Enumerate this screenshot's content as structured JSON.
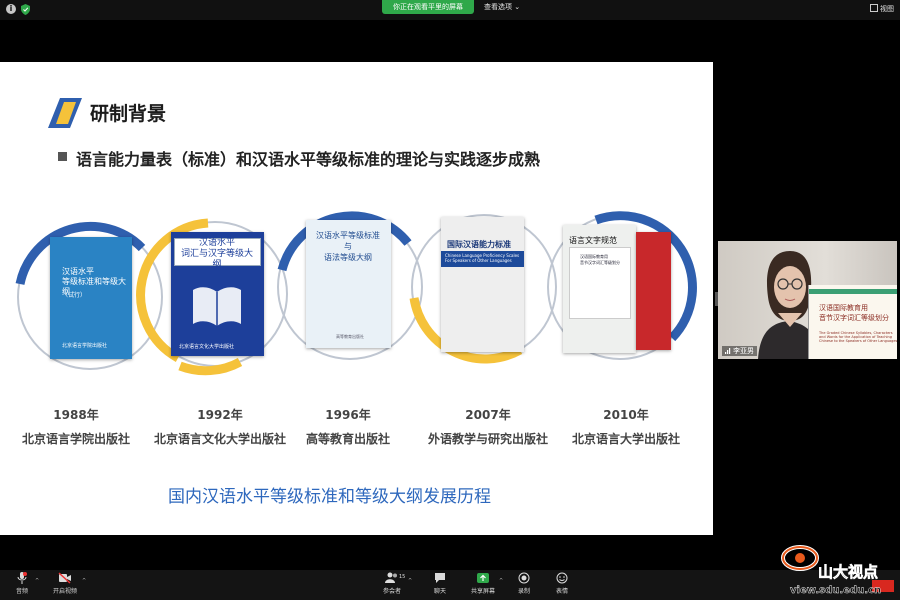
{
  "topbar": {
    "sharing_banner": "你正在观看平里的屏幕",
    "view_options": "查看选项",
    "view_button": "视图"
  },
  "slide": {
    "title": "研制背景",
    "subtitle": "语言能力量表（标准）和汉语水平等级标准的理论与实践逐步成熟",
    "caption": "国内汉语水平等级标准和等级大纲发展历程",
    "timeline": [
      {
        "year": "1988年",
        "publisher": "北京语言学院出版社",
        "arc_color": "#2f5fae"
      },
      {
        "year": "1992年",
        "publisher": "北京语言文化大学出版社",
        "arc_color": "#f5c23a"
      },
      {
        "year": "1996年",
        "publisher": "高等教育出版社",
        "arc_color": "#2f5fae"
      },
      {
        "year": "2007年",
        "publisher": "外语教学与研究出版社",
        "arc_color": "#f5c23a"
      },
      {
        "year": "2010年",
        "publisher": "北京语言大学出版社",
        "arc_color": "#2f5fae"
      }
    ],
    "books": {
      "b1": {
        "title": "汉语水平\n等级标准和等级大纲",
        "sub": "（试行）",
        "pub": "北京语言学院出版社"
      },
      "b2": {
        "title": "汉语水平\n词汇与汉字等级大纲",
        "pub": "北京语言文化大学出版社"
      },
      "b3": {
        "title": "汉语水平等级标准\n与\n语法等级大纲",
        "pub": "高等教育出版社"
      },
      "b4": {
        "title": "国际汉语能力标准",
        "en": "Chinese Language Proficiency Scales\nFor Speakers of Other Languages"
      },
      "b5": {
        "title": "语言文字规范",
        "inner": "汉语国际教育用\n音节汉字词汇等级划分"
      }
    }
  },
  "video": {
    "participant_name": "李亚男",
    "book_title": "汉语国际教育用\n音节汉字词汇等级划分",
    "book_en": "The Graded Chinese Syllables, Characters and Words for the Application of Teaching Chinese to the Speakers of Other Languages"
  },
  "toolbar": {
    "audio": "音频",
    "video": "开启视频",
    "participants": "参会者",
    "participants_count": "15",
    "chat": "聊天",
    "share": "共享屏幕",
    "record": "录制",
    "reactions": "表情"
  },
  "watermark": {
    "brand": "山大视点",
    "url": "view.sdu.edu.cn"
  },
  "colors": {
    "accent_blue": "#2f5fae",
    "accent_yellow": "#f5c23a",
    "caption_blue": "#2e68bd",
    "share_green": "#2fa84a"
  }
}
